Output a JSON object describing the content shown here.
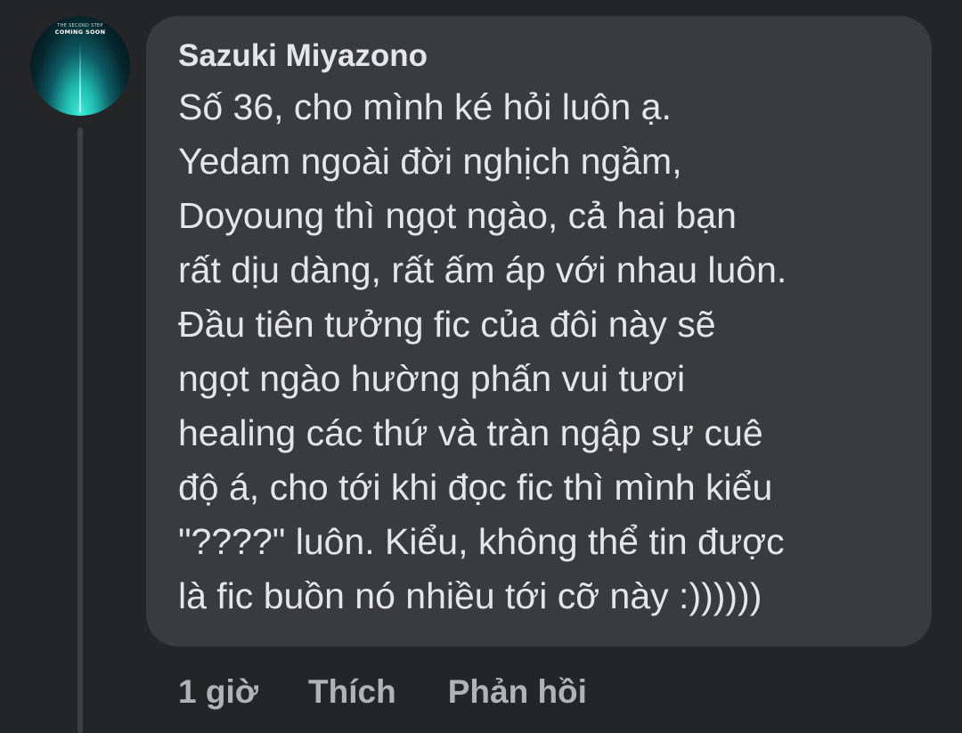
{
  "avatar": {
    "caption_small": "THE SECOND STEP",
    "caption_big": "COMING SOON"
  },
  "comment": {
    "author": "Sazuki Miyazono",
    "lines": [
      "Số 36, cho mình ké hỏi luôn ạ.",
      "Yedam ngoài đời nghịch ngầm,",
      "Doyoung thì ngọt ngào, cả hai bạn",
      "rất dịu dàng, rất ấm áp với nhau luôn.",
      "Đầu tiên tưởng fic của đôi này sẽ",
      "ngọt ngào hường phấn vui tươi",
      "healing các thứ và tràn ngập sự cuê",
      "độ á, cho tới khi đọc fic thì mình kiểu",
      "\"????\" luôn. Kiểu, không thể tin được",
      "là fic buồn nó nhiều tới cỡ này :))))))"
    ]
  },
  "actions": {
    "time": "1 giờ",
    "like": "Thích",
    "reply": "Phản hồi"
  },
  "colors": {
    "background": "#242526",
    "bubble": "#3a3b3c",
    "text_primary": "#e4e6eb",
    "text_secondary": "#b0b3b8"
  }
}
